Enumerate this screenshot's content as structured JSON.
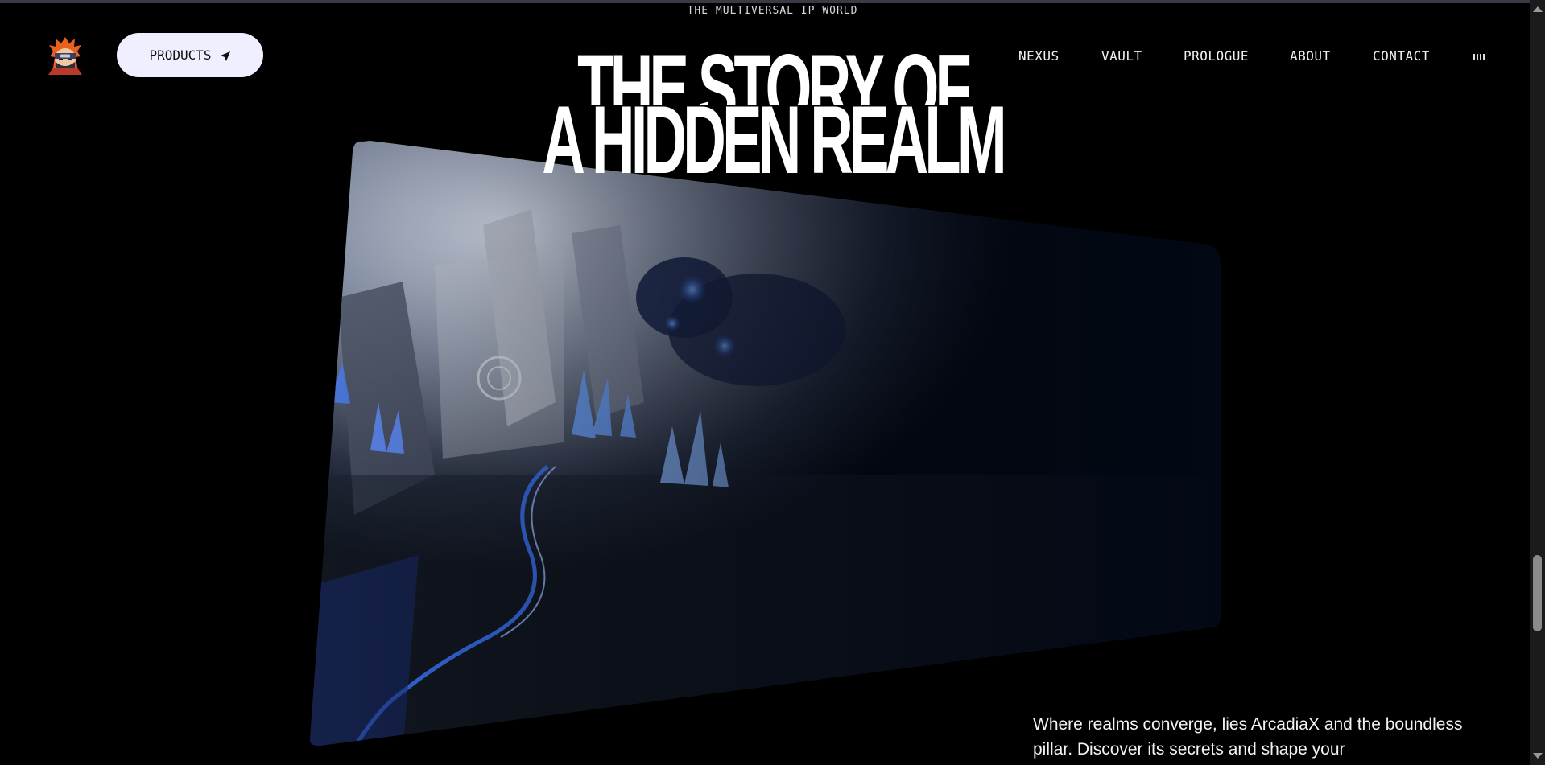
{
  "eyebrow": "THE MULTIVERSAL IP WORLD",
  "header": {
    "logo_icon": "ninja-avatar-icon",
    "products_label": "PRODUCTS",
    "products_icon": "paper-plane-icon",
    "nav": [
      {
        "label": "NEXUS"
      },
      {
        "label": "VAULT"
      },
      {
        "label": "PROLOGUE"
      },
      {
        "label": "ABOUT"
      },
      {
        "label": "CONTACT"
      }
    ],
    "audio_icon": "audio-bars-icon"
  },
  "hero": {
    "title_line1": "THE STORY OF",
    "title_line2": "A HIDDEN REALM",
    "image_alt_icon": "crystal-cave-image",
    "accent_color": "#2b5fe0"
  },
  "intro": {
    "text": "Where realms converge, lies ArcadiaX and the boundless pillar. Discover its secrets and shape your"
  },
  "colors": {
    "background": "#000000",
    "button_bg": "#f0efff"
  }
}
